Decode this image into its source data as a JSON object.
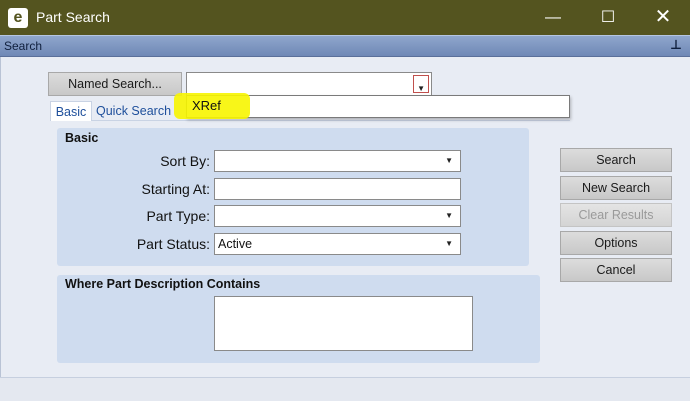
{
  "window": {
    "title": "Part Search",
    "icon_letter": "e",
    "controls": {
      "minimize": "—",
      "maximize": "☐",
      "close": "✕"
    }
  },
  "panel": {
    "title": "Search",
    "pin_glyph": "⊥"
  },
  "named_search": {
    "button_label": "Named Search...",
    "value": ""
  },
  "dropdown_options": [
    "XRef"
  ],
  "tabs": [
    {
      "label": "Basic",
      "active": true
    },
    {
      "label": "Quick Search",
      "active": false
    }
  ],
  "basic_group": {
    "title": "Basic",
    "fields": {
      "sort_by": {
        "label": "Sort By:",
        "value": ""
      },
      "starting_at": {
        "label": "Starting At:",
        "value": ""
      },
      "part_type": {
        "label": "Part Type:",
        "value": ""
      },
      "part_status": {
        "label": "Part Status:",
        "value": "Active"
      }
    }
  },
  "description_group": {
    "title": "Where Part Description Contains",
    "value": ""
  },
  "actions": {
    "search": "Search",
    "new_search": "New Search",
    "clear_results": "Clear Results",
    "options": "Options",
    "cancel": "Cancel"
  },
  "colors": {
    "titlebar": "#54541f",
    "panel_header": "#7f97c2",
    "group_background": "#cfdcef",
    "highlight": "#f7f500"
  }
}
